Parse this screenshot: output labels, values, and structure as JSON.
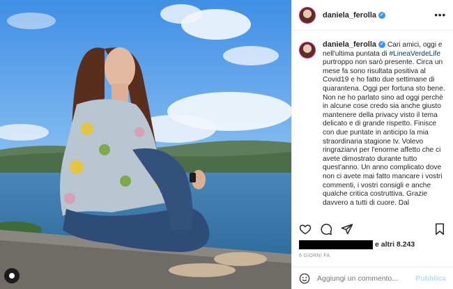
{
  "post": {
    "username": "daniela_ferolla",
    "more_label": "•••"
  },
  "caption": {
    "username": "daniela_ferolla",
    "text_before_hashtag": "Cari amici, oggi e nell'ultima puntata di ",
    "hashtag": "#LineaVerdeLife",
    "text_after_hashtag": " purtroppo non sarò presente. Circa un mese fa sono risultata positiva al Covid19 e ho fatto due settimane di quarantena. Oggi per fortuna sto bene. Non ne ho parlato sino ad oggi perchè in alcune cose credo sia anche giusto mantenere della privacy visto il tema delicato e di grande rispetto. Finisce con due puntate in anticipo la mia straordinaria stagione tv. Volevo ringraziarvi per l'enorme affetto che ci avete dimostrato durante tutto quest'anno. Un anno complicato dove non ci avete mai fatto mancare i vostri commenti, i vostri consigli e anche qualche critica costruttiva. Grazie davvero a tutti di cuore. Dal"
  },
  "likes": {
    "label": "e altri 8.243"
  },
  "timestamp": "6 GIORNI FA",
  "comment": {
    "placeholder": "Aggiungi un commento...",
    "publish_label": "Pubblica"
  },
  "colors": {
    "hashtag": "#00376b",
    "verified": "#3897f0",
    "publish": "#b2dffc"
  },
  "icons": [
    "heart-icon",
    "comment-icon",
    "share-icon",
    "bookmark-icon",
    "emoji-icon",
    "verified-badge-icon",
    "more-options-icon"
  ]
}
